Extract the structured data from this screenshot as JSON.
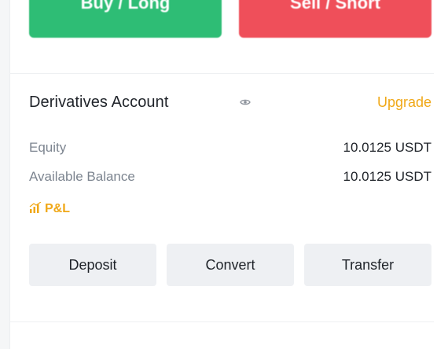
{
  "trade": {
    "buy_label": "Buy / Long",
    "sell_label": "Sell / Short"
  },
  "account": {
    "title": "Derivatives Account",
    "upgrade_label": "Upgrade",
    "rows": [
      {
        "label": "Equity",
        "value": "10.0125 USDT"
      },
      {
        "label": "Available Balance",
        "value": "10.0125 USDT"
      }
    ],
    "pnl_label": "P&L"
  },
  "actions": {
    "deposit": "Deposit",
    "convert": "Convert",
    "transfer": "Transfer"
  },
  "colors": {
    "buy": "#2ebd75",
    "sell": "#ef4f5a",
    "accent": "#f0a818",
    "button_bg": "#eef0f3"
  },
  "icons": {
    "eye": "eye-icon",
    "pnl": "chart-icon"
  }
}
